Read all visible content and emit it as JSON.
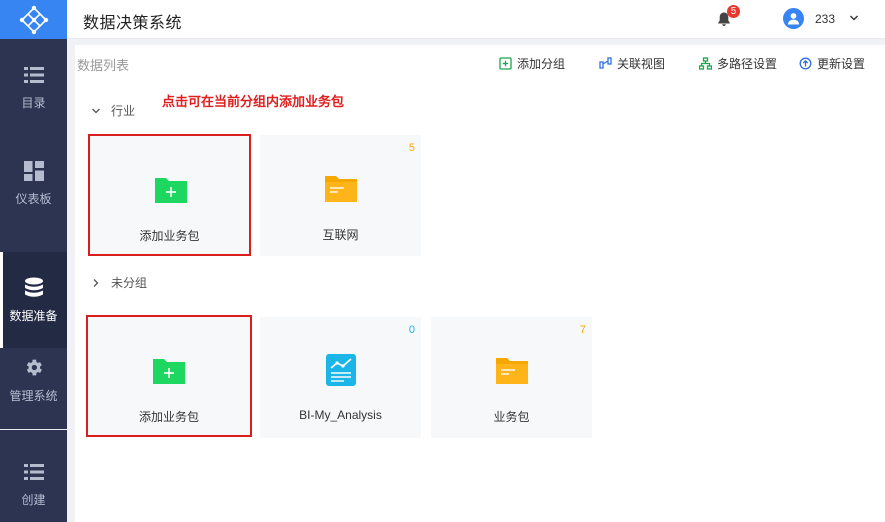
{
  "app": {
    "title": "数据决策系统"
  },
  "sidebar": {
    "items": [
      {
        "label": "目录",
        "icon": "list-icon"
      },
      {
        "label": "仪表板",
        "icon": "dashboard-icon"
      },
      {
        "label": "数据准备",
        "icon": "database-icon",
        "active": true
      },
      {
        "label": "管理系统",
        "icon": "gear-icon"
      },
      {
        "label": "创建",
        "icon": "list-icon"
      }
    ]
  },
  "header": {
    "notification_count": "5",
    "username": "233"
  },
  "panel": {
    "title": "数据列表",
    "toolbar": {
      "add_group": "添加分组",
      "relation_view": "关联视图",
      "multipath": "多路径设置",
      "update": "更新设置"
    },
    "hint": "点击可在当前分组内添加业务包",
    "groups": [
      {
        "name": "行业",
        "expanded": true,
        "cards": [
          {
            "label": "添加业务包",
            "type": "add"
          },
          {
            "label": "互联网",
            "type": "folder",
            "count": "5"
          }
        ]
      },
      {
        "name": "未分组",
        "expanded": false,
        "cards": [
          {
            "label": "添加业务包",
            "type": "add"
          },
          {
            "label": "BI-My_Analysis",
            "type": "analysis",
            "count": "0"
          },
          {
            "label": "业务包",
            "type": "folder",
            "count": "7"
          }
        ]
      }
    ]
  },
  "colors": {
    "sidebar_bg": "#2c3452",
    "accent_blue": "#3685f2",
    "add_green": "#1ed760",
    "folder_orange": "#f7a800",
    "analysis_cyan": "#1bb5e8",
    "highlight_red": "#d91e1e"
  }
}
